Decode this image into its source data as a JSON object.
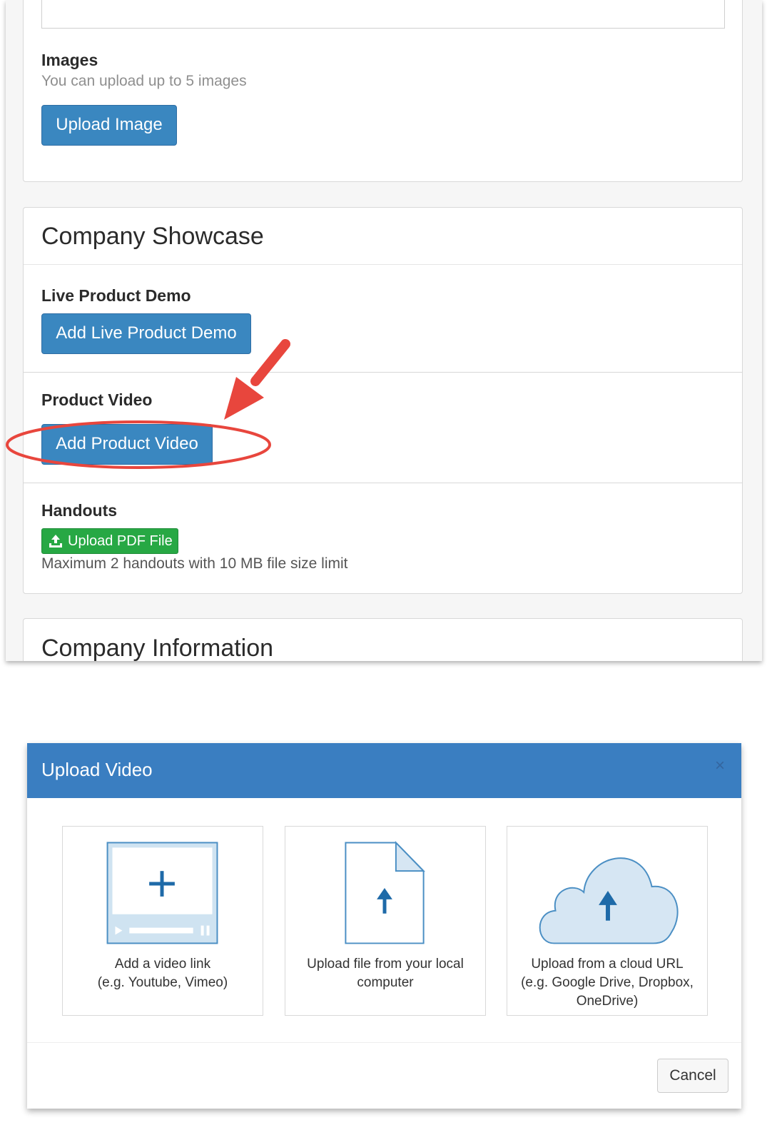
{
  "images_section": {
    "label": "Images",
    "help": "You can upload up to 5 images",
    "upload_button": "Upload Image"
  },
  "showcase": {
    "title": "Company Showcase",
    "live_demo": {
      "label": "Live Product Demo",
      "button": "Add Live Product Demo"
    },
    "product_video": {
      "label": "Product Video",
      "button": "Add Product Video"
    },
    "handouts": {
      "label": "Handouts",
      "button": "Upload PDF File",
      "help": "Maximum 2 handouts with 10 MB file size limit"
    }
  },
  "company_information": {
    "title": "Company Information"
  },
  "modal": {
    "title": "Upload Video",
    "close": "×",
    "options": [
      {
        "line1": "Add a video link",
        "line2": "(e.g. Youtube, Vimeo)",
        "icon": "video-player-plus-icon"
      },
      {
        "line1": "Upload file from your local",
        "line2": "computer",
        "icon": "file-upload-icon"
      },
      {
        "line1": "Upload from a cloud URL",
        "line2": "(e.g. Google Drive, Dropbox,",
        "line3": "OneDrive)",
        "icon": "cloud-upload-icon"
      }
    ],
    "cancel": "Cancel"
  },
  "colors": {
    "primary": "#3a87c0",
    "success": "#27a844",
    "modal_header": "#3a7ec1",
    "annotation_red": "#e8463d"
  }
}
